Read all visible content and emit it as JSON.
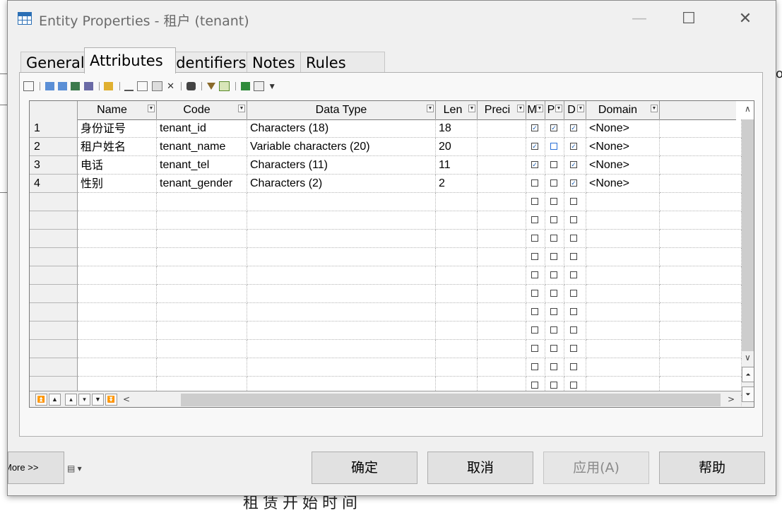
{
  "window": {
    "title": "Entity Properties - 租户 (tenant)",
    "minimize": "—",
    "maximize": "☐",
    "close": "✕"
  },
  "background": {
    "bottom_text": "租赁开始时间",
    "right_char": "o"
  },
  "tabs": [
    {
      "label": "General",
      "active": false
    },
    {
      "label": "Attributes",
      "active": true
    },
    {
      "label": "Identifiers",
      "active": false
    },
    {
      "label": "Notes",
      "active": false
    },
    {
      "label": "Rules",
      "active": false
    }
  ],
  "grid": {
    "headers": [
      "Name",
      "Code",
      "Data Type",
      "Len",
      "Preci",
      "M",
      "P",
      "D",
      "Domain"
    ],
    "rows": [
      {
        "num": "1",
        "name": "身份证号",
        "code": "tenant_id",
        "type": "Characters (18)",
        "len": "18",
        "preci": "",
        "m": true,
        "p": true,
        "d": true,
        "domain": "<None>"
      },
      {
        "num": "2",
        "name": "租户姓名",
        "code": "tenant_name",
        "type": "Variable characters (20)",
        "len": "20",
        "preci": "",
        "m": true,
        "p": false,
        "d": true,
        "domain": "<None>"
      },
      {
        "num": "3",
        "name": "电话",
        "code": "tenant_tel",
        "type": "Characters (11)",
        "len": "11",
        "preci": "",
        "m": true,
        "p": false,
        "d": true,
        "domain": "<None>"
      },
      {
        "num": "4",
        "name": "性别",
        "code": "tenant_gender",
        "type": "Characters (2)",
        "len": "2",
        "preci": "",
        "m": false,
        "p": false,
        "d": true,
        "domain": "<None>"
      }
    ],
    "empty_rows": 12
  },
  "buttons": {
    "more": "More >>",
    "ok": "确定",
    "cancel": "取消",
    "apply": "应用(A)",
    "help": "帮助"
  },
  "colors": {
    "checkbox_check": "#1a5fb4",
    "focus_blue": "#2a6fd6"
  }
}
